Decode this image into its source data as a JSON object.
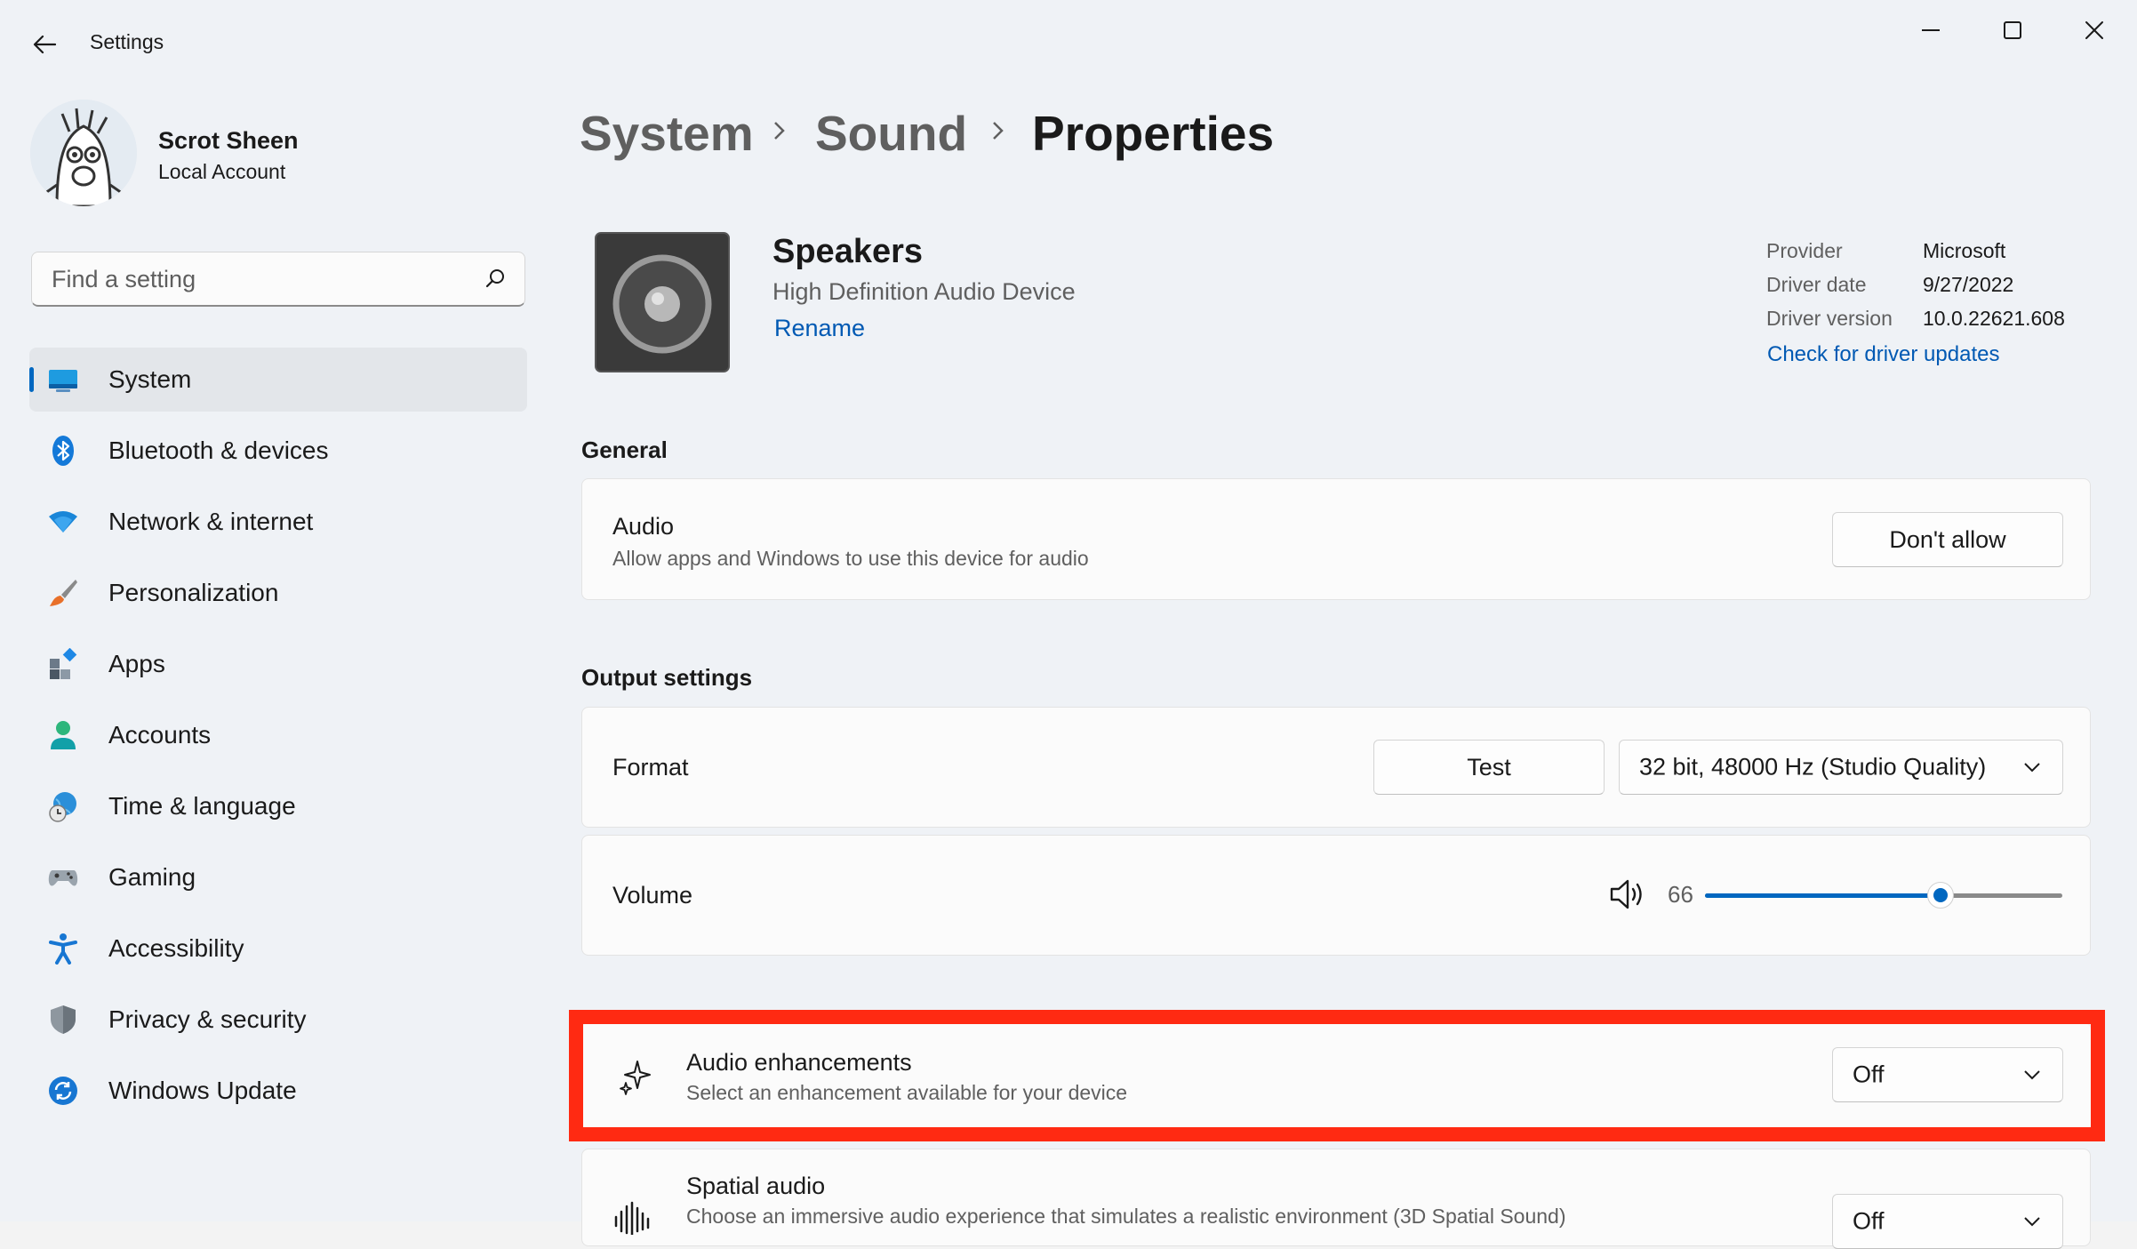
{
  "window": {
    "title": "Settings",
    "controls": [
      "minimize",
      "maximize",
      "close"
    ]
  },
  "user": {
    "name": "Scrot Sheen",
    "account_type": "Local Account"
  },
  "search": {
    "placeholder": "Find a setting"
  },
  "sidebar": {
    "items": [
      {
        "label": "System",
        "icon": "system-icon",
        "active": true
      },
      {
        "label": "Bluetooth & devices",
        "icon": "bluetooth-icon"
      },
      {
        "label": "Network & internet",
        "icon": "wifi-icon"
      },
      {
        "label": "Personalization",
        "icon": "brush-icon"
      },
      {
        "label": "Apps",
        "icon": "apps-icon"
      },
      {
        "label": "Accounts",
        "icon": "person-icon"
      },
      {
        "label": "Time & language",
        "icon": "globe-clock-icon"
      },
      {
        "label": "Gaming",
        "icon": "controller-icon"
      },
      {
        "label": "Accessibility",
        "icon": "accessibility-icon"
      },
      {
        "label": "Privacy & security",
        "icon": "shield-icon"
      },
      {
        "label": "Windows Update",
        "icon": "update-icon"
      }
    ]
  },
  "breadcrumb": [
    "System",
    "Sound",
    "Properties"
  ],
  "device": {
    "name": "Speakers",
    "description": "High Definition Audio Device",
    "rename_label": "Rename",
    "icon": "speaker-icon"
  },
  "driver": {
    "provider_label": "Provider",
    "provider": "Microsoft",
    "date_label": "Driver date",
    "date": "9/27/2022",
    "version_label": "Driver version",
    "version": "10.0.22621.608",
    "update_link": "Check for driver updates"
  },
  "general": {
    "title": "General",
    "audio": {
      "title": "Audio",
      "subtitle": "Allow apps and Windows to use this device for audio",
      "button": "Don't allow"
    }
  },
  "output": {
    "title": "Output settings",
    "format": {
      "title": "Format",
      "test_button": "Test",
      "selected": "32 bit, 48000 Hz (Studio Quality)"
    },
    "volume": {
      "title": "Volume",
      "value": "66",
      "level_percent": 66
    },
    "enhancements": {
      "title": "Audio enhancements",
      "subtitle": "Select an enhancement available for your device",
      "selected": "Off"
    },
    "spatial": {
      "title": "Spatial audio",
      "subtitle": "Choose an immersive audio experience that simulates a realistic environment (3D Spatial Sound)",
      "selected": "Off"
    }
  },
  "colors": {
    "accent": "#0067c0",
    "link": "#0059b3",
    "highlight_box": "#ff2a12"
  }
}
